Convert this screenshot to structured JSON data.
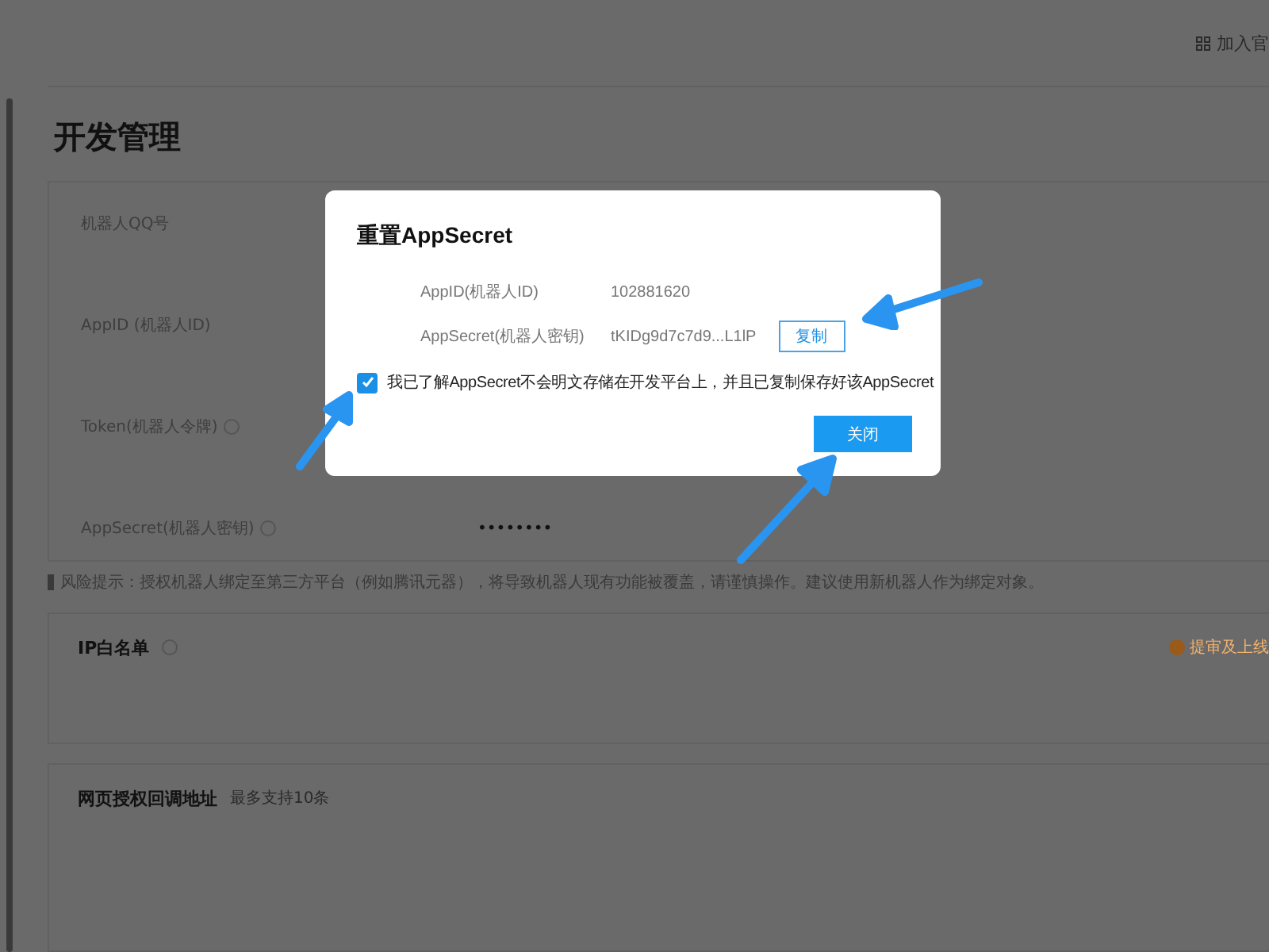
{
  "header": {
    "link": "加入官"
  },
  "page_title": "开发管理",
  "credentials": [
    {
      "label": "机器人QQ号",
      "help": false
    },
    {
      "label": "AppID (机器人ID)",
      "help": false
    },
    {
      "label": "Token(机器人令牌)",
      "help": true
    },
    {
      "label": "AppSecret(机器人密钥)",
      "help": true,
      "value": "••••••••"
    }
  ],
  "risk_note": "风险提示：授权机器人绑定至第三方平台（例如腾讯元器），将导致机器人现有功能被覆盖，请谨慎操作。建议使用新机器人作为绑定对象。",
  "sections": [
    {
      "title": "IP白名单",
      "help": true,
      "notice": "提审及上线"
    },
    {
      "title": "网页授权回调地址",
      "hint": "最多支持10条"
    }
  ],
  "dialog": {
    "title": "重置AppSecret",
    "rows": [
      {
        "label": "AppID(机器人ID)",
        "value": "102881620"
      },
      {
        "label": "AppSecret(机器人密钥)",
        "value": "tKIDg9d7c7d9...L1lP",
        "action": "复制"
      }
    ],
    "confirm": {
      "checked": true,
      "text": "我已了解AppSecret不会明文存储在开发平台上，并且已复制保存好该AppSecret"
    },
    "button": "关闭"
  }
}
